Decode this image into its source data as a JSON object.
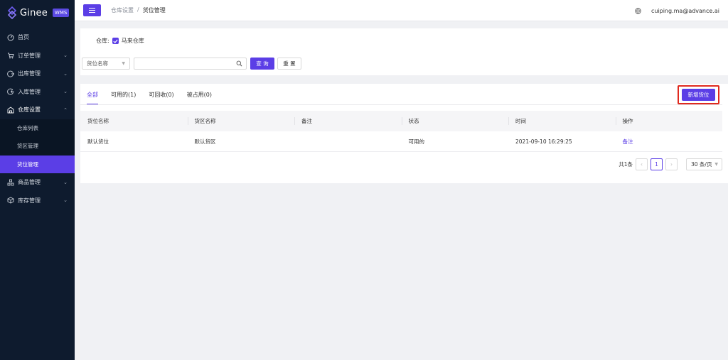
{
  "brand": {
    "name": "Ginee",
    "badge": "WMS",
    "accent": "#5b3ee6"
  },
  "sidebar": {
    "items": [
      {
        "label": "首页",
        "icon": "dashboard-icon"
      },
      {
        "label": "订单管理",
        "icon": "cart-icon"
      },
      {
        "label": "出库管理",
        "icon": "outbound-icon"
      },
      {
        "label": "入库管理",
        "icon": "inbound-icon"
      },
      {
        "label": "仓库设置",
        "icon": "warehouse-icon"
      },
      {
        "label": "商品管理",
        "icon": "product-icon"
      },
      {
        "label": "库存管理",
        "icon": "inventory-icon"
      }
    ],
    "sub_items": [
      {
        "label": "仓库列表"
      },
      {
        "label": "货区管理"
      },
      {
        "label": "货位管理"
      }
    ]
  },
  "header": {
    "breadcrumb": [
      "仓库设置",
      "/",
      "货位管理"
    ],
    "user_email": "cuiping.ma@advance.ai"
  },
  "filter": {
    "warehouse_label": "仓库:",
    "warehouse_value": "马来仓库",
    "field_select": "货位名称",
    "search_value": "",
    "query_label": "查 询",
    "reset_label": "重 置"
  },
  "tabs": [
    {
      "label": "全部"
    },
    {
      "label": "可用的(1)"
    },
    {
      "label": "可回收(0)"
    },
    {
      "label": "被占用(0)"
    }
  ],
  "add_button": "新增货位",
  "table": {
    "columns": [
      "货位名称",
      "货区名称",
      "备注",
      "状态",
      "时间",
      "操作"
    ],
    "rows": [
      [
        "默认货位",
        "默认货区",
        "",
        "可用的",
        "2021-09-10 16:29:25",
        "备注"
      ]
    ]
  },
  "pagination": {
    "total_text": "共1条",
    "current_page": "1",
    "page_size": "30 条/页"
  }
}
